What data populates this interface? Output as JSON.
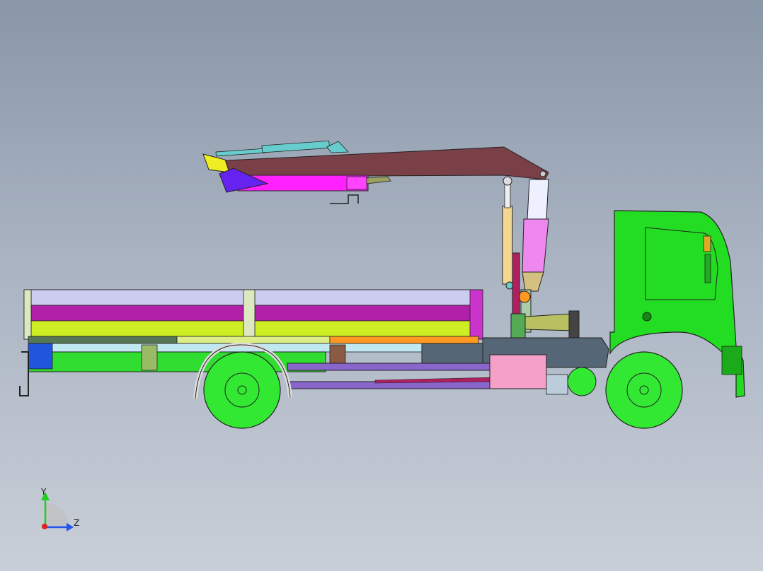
{
  "viewport": {
    "background_top": "#8a97a8",
    "background_bottom": "#c9cfd8"
  },
  "model": {
    "description_icon": "truck-crane-assembly-icon"
  },
  "colors": {
    "cab": "#22dd22",
    "wheel": "#33e833",
    "boom": "#7a4048",
    "crane_column": "#ee88ee",
    "magenta_panel": "#b020a8",
    "yellow_panel": "#ccee22",
    "lavender_panel": "#ccccf0",
    "cylinder": "#f0d890",
    "jib_magenta": "#ff22ff",
    "jib_blue": "#6622ee",
    "outrigger_pink": "#f4a0c8",
    "frame_green": "#30dd30"
  },
  "axis_triad": {
    "y_label": "Y",
    "z_label": "Z"
  }
}
